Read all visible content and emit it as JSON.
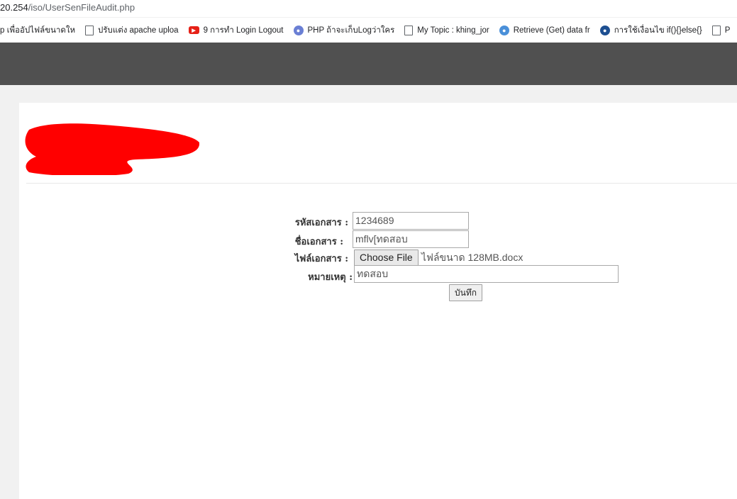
{
  "browser": {
    "url_host": "20.254",
    "url_path": "/iso/UserSenFileAudit.php"
  },
  "bookmarks": [
    {
      "icon": "page-icon",
      "label": "p เพื่ออัปไฟล์ขนาดให"
    },
    {
      "icon": "page-icon",
      "label": "ปรับแต่ง apache uploa"
    },
    {
      "icon": "youtube-icon",
      "label": "9 การทำ Login Logout"
    },
    {
      "icon": "php-icon",
      "label": "PHP ถ้าจะเก็บLogว่าใคร"
    },
    {
      "icon": "page-icon",
      "label": "My Topic : khing_jor"
    },
    {
      "icon": "retrieve-icon",
      "label": "Retrieve (Get) data fr"
    },
    {
      "icon": "site-icon",
      "label": "การใช้เงื่อนไข if(){}else{}"
    },
    {
      "icon": "page-icon",
      "label": "P"
    }
  ],
  "form": {
    "doc_code_label": "รหัสเอกสาร :",
    "doc_code_value": "1234689",
    "doc_name_label": "ชื่อเอกสาร :",
    "doc_name_value": "mflv[ทดสอบ",
    "doc_file_label": "ไฟล์เอกสาร :",
    "choose_file_label": "Choose File",
    "file_name": "ไฟล์ขนาด 128MB.docx",
    "remark_label": "หมายเหตุ :",
    "remark_value": "ทดสอบ",
    "submit_label": "บันทึก"
  },
  "colors": {
    "topbar": "#505050",
    "redaction": "#ff0000"
  }
}
